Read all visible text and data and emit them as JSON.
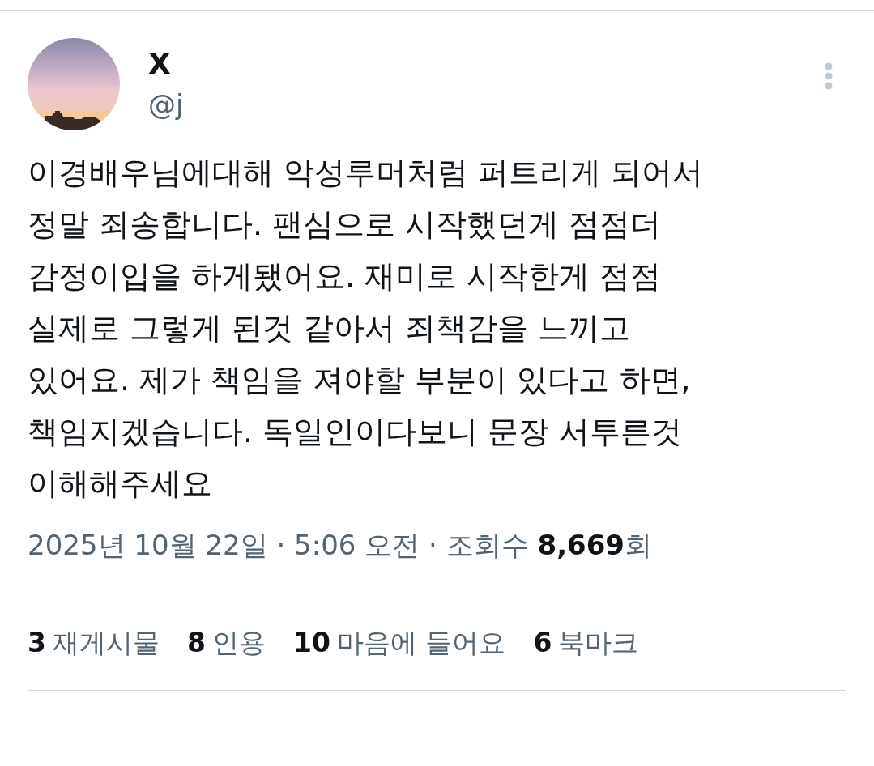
{
  "author": {
    "name": "X",
    "handle": "@j"
  },
  "post": {
    "text": "이경배우님에대해 악성루머처럼 퍼트리게 되어서\n정말 죄송합니다. 팬심으로 시작했던게 점점더\n감정이입을 하게됐어요. 재미로 시작한게 점점\n실제로 그렇게 된것 같아서 죄책감을 느끼고\n있어요. 제가 책임을 져야할 부분이 있다고 하면,\n책임지겠습니다. 독일인이다보니 문장 서투른것\n이해해주세요"
  },
  "meta": "2025년 10월 22일 · 5:06 오전 · 조회수 **8,669**회",
  "stats": [
    {
      "count": "3",
      "label": "재게시물"
    },
    {
      "count": "8",
      "label": "인용"
    },
    {
      "count": "10",
      "label": "마음에 들어요"
    },
    {
      "count": "6",
      "label": "북마크"
    }
  ]
}
